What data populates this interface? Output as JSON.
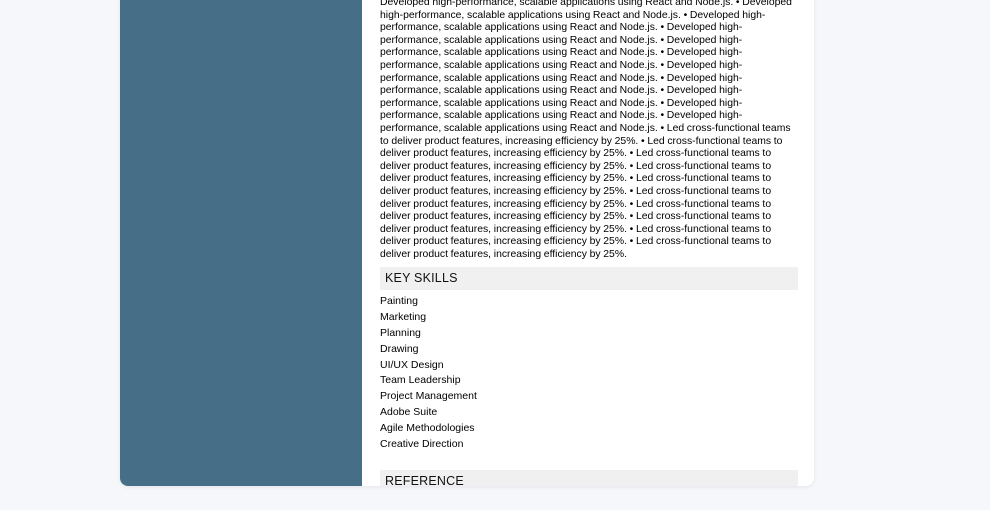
{
  "experience": {
    "text": "Developed high-performance, scalable applications using React and Node.js. • Developed high-performance, scalable applications using React and Node.js. • Developed high-performance, scalable applications using React and Node.js. • Developed high-performance, scalable applications using React and Node.js. • Developed high-performance, scalable applications using React and Node.js. • Developed high-performance, scalable applications using React and Node.js. • Developed high-performance, scalable applications using React and Node.js. • Developed high-performance, scalable applications using React and Node.js. • Developed high-performance, scalable applications using React and Node.js. • Developed high-performance, scalable applications using React and Node.js. • Developed high-performance, scalable applications using React and Node.js. • Led cross-functional teams to deliver product features, increasing efficiency by 25%. • Led cross-functional teams to deliver product features, increasing efficiency by 25%. • Led cross-functional teams to deliver product features, increasing efficiency by 25%. • Led cross-functional teams to deliver product features, increasing efficiency by 25%. • Led cross-functional teams to deliver product features, increasing efficiency by 25%. • Led cross-functional teams to deliver product features, increasing efficiency by 25%. • Led cross-functional teams to deliver product features, increasing efficiency by 25%. • Led cross-functional teams to deliver product features, increasing efficiency by 25%. • Led cross-functional teams to deliver product features, increasing efficiency by 25%. • Led cross-functional teams to deliver product features, increasing efficiency by 25%."
  },
  "skills": {
    "title": "KEY SKILLS",
    "items": [
      "Painting",
      "Marketing",
      "Planning",
      "Drawing",
      "UI/UX Design",
      "Team Leadership",
      "Project Management",
      "Adobe Suite",
      "Agile Methodologies",
      "Creative Direction"
    ]
  },
  "reference": {
    "title": "REFERENCE"
  },
  "colors": {
    "sidebar": "#466f87",
    "section_header_bg": "#f0f0f0",
    "page_bg": "#f5f7fa"
  }
}
